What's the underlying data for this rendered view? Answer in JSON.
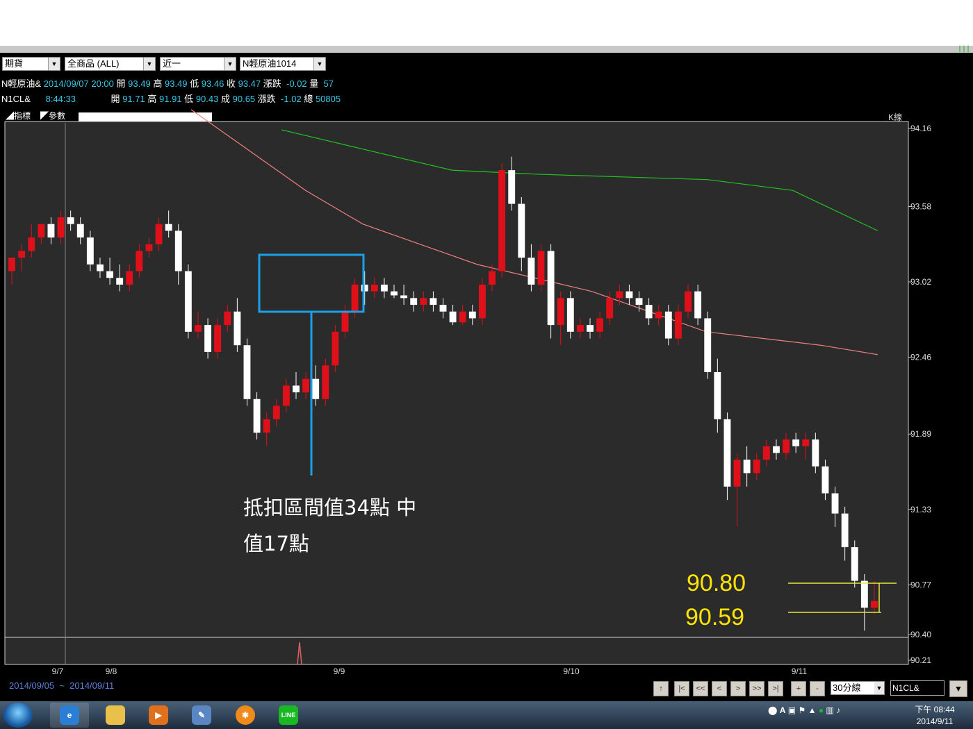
{
  "toolbar": {
    "market_select": "期貨",
    "product_select": "全商品    (ALL)",
    "month_select": "近一",
    "contract_select": "N輕原油1014"
  },
  "quote": {
    "row1": {
      "symbol": "N輕原油&",
      "datetime": "2014/09/07 20:00",
      "open_label": "開",
      "open": "93.49",
      "high_label": "高",
      "high": "93.49",
      "low_label": "低",
      "low": "93.46",
      "close_label": "收",
      "close": "93.47",
      "change_label": "漲跌",
      "change": "-0.02",
      "volume_label": "量",
      "volume": "57"
    },
    "row2": {
      "symbol": "N1CL&",
      "time": "8:44:33",
      "open_label": "開",
      "open": "91.71",
      "high_label": "高",
      "high": "91.91",
      "low_label": "低",
      "low": "90.43",
      "close_label": "成",
      "close": "90.65",
      "change_label": "漲跌",
      "change": "-1.02",
      "volume_label": "總",
      "volume": "50805"
    }
  },
  "indicator_bar": {
    "indicator_label": "指標",
    "param_label": "參數",
    "chart_type": "K線"
  },
  "chart_data": {
    "type": "candlestick",
    "symbol": "N1CL&",
    "interval": "30分線",
    "y_ticks": [
      "94.16",
      "93.58",
      "93.02",
      "92.46",
      "91.89",
      "91.33",
      "90.77",
      "90.40",
      "90.21"
    ],
    "ylim": [
      90.21,
      94.16
    ],
    "x_ticks": [
      "9/7",
      "9/8",
      "9/9",
      "9/10",
      "9/11"
    ],
    "candles": [
      [
        93.1,
        93.2,
        93.0,
        93.2
      ],
      [
        93.2,
        93.3,
        93.1,
        93.25
      ],
      [
        93.25,
        93.45,
        93.2,
        93.35
      ],
      [
        93.35,
        93.45,
        93.3,
        93.45
      ],
      [
        93.45,
        93.5,
        93.3,
        93.35
      ],
      [
        93.35,
        93.55,
        93.3,
        93.5
      ],
      [
        93.5,
        93.55,
        93.4,
        93.45
      ],
      [
        93.45,
        93.5,
        93.3,
        93.35
      ],
      [
        93.35,
        93.4,
        93.1,
        93.15
      ],
      [
        93.15,
        93.2,
        93.05,
        93.1
      ],
      [
        93.1,
        93.2,
        93.0,
        93.05
      ],
      [
        93.05,
        93.15,
        92.95,
        93.0
      ],
      [
        93.0,
        93.15,
        92.95,
        93.1
      ],
      [
        93.1,
        93.3,
        93.05,
        93.25
      ],
      [
        93.25,
        93.35,
        93.2,
        93.3
      ],
      [
        93.3,
        93.5,
        93.25,
        93.45
      ],
      [
        93.45,
        93.55,
        93.35,
        93.4
      ],
      [
        93.4,
        93.45,
        93.0,
        93.1
      ],
      [
        93.1,
        93.15,
        92.6,
        92.65
      ],
      [
        92.65,
        92.8,
        92.6,
        92.7
      ],
      [
        92.7,
        92.75,
        92.45,
        92.5
      ],
      [
        92.5,
        92.75,
        92.45,
        92.7
      ],
      [
        92.7,
        92.85,
        92.65,
        92.8
      ],
      [
        92.8,
        92.9,
        92.5,
        92.55
      ],
      [
        92.55,
        92.6,
        92.1,
        92.15
      ],
      [
        92.15,
        92.2,
        91.85,
        91.9
      ],
      [
        91.9,
        92.05,
        91.8,
        92.0
      ],
      [
        92.0,
        92.15,
        91.95,
        92.1
      ],
      [
        92.1,
        92.3,
        92.05,
        92.25
      ],
      [
        92.25,
        92.35,
        92.15,
        92.2
      ],
      [
        92.2,
        92.35,
        92.15,
        92.3
      ],
      [
        92.3,
        92.4,
        92.1,
        92.15
      ],
      [
        92.15,
        92.45,
        92.1,
        92.4
      ],
      [
        92.4,
        92.7,
        92.35,
        92.65
      ],
      [
        92.65,
        92.85,
        92.6,
        92.8
      ],
      [
        92.8,
        93.05,
        92.75,
        93.0
      ],
      [
        93.0,
        93.1,
        92.85,
        92.95
      ],
      [
        92.95,
        93.05,
        92.9,
        93.0
      ],
      [
        93.0,
        93.05,
        92.9,
        92.95
      ],
      [
        92.95,
        93.0,
        92.9,
        92.92
      ],
      [
        92.92,
        93.0,
        92.85,
        92.9
      ],
      [
        92.9,
        92.95,
        92.8,
        92.85
      ],
      [
        92.85,
        92.95,
        92.8,
        92.9
      ],
      [
        92.9,
        92.95,
        92.8,
        92.85
      ],
      [
        92.85,
        92.9,
        92.75,
        92.8
      ],
      [
        92.8,
        92.85,
        92.7,
        92.72
      ],
      [
        92.72,
        92.85,
        92.7,
        92.8
      ],
      [
        92.8,
        92.85,
        92.7,
        92.75
      ],
      [
        92.75,
        93.05,
        92.7,
        93.0
      ],
      [
        93.0,
        93.15,
        92.95,
        93.1
      ],
      [
        93.1,
        93.9,
        93.05,
        93.85
      ],
      [
        93.85,
        93.95,
        93.55,
        93.6
      ],
      [
        93.6,
        93.65,
        93.1,
        93.2
      ],
      [
        93.2,
        93.3,
        92.95,
        93.0
      ],
      [
        93.0,
        93.3,
        92.95,
        93.25
      ],
      [
        93.25,
        93.3,
        92.6,
        92.7
      ],
      [
        92.7,
        92.95,
        92.55,
        92.9
      ],
      [
        92.9,
        92.95,
        92.6,
        92.65
      ],
      [
        92.65,
        92.75,
        92.6,
        92.7
      ],
      [
        92.7,
        92.75,
        92.6,
        92.65
      ],
      [
        92.65,
        92.8,
        92.6,
        92.75
      ],
      [
        92.75,
        92.95,
        92.7,
        92.9
      ],
      [
        92.9,
        93.0,
        92.85,
        92.95
      ],
      [
        92.95,
        93.0,
        92.85,
        92.9
      ],
      [
        92.9,
        92.95,
        92.8,
        92.85
      ],
      [
        92.85,
        92.9,
        92.7,
        92.75
      ],
      [
        92.75,
        92.85,
        92.7,
        92.8
      ],
      [
        92.8,
        92.85,
        92.55,
        92.6
      ],
      [
        92.6,
        92.85,
        92.55,
        92.8
      ],
      [
        92.8,
        93.0,
        92.75,
        92.95
      ],
      [
        92.95,
        93.0,
        92.7,
        92.75
      ],
      [
        92.75,
        92.8,
        92.3,
        92.35
      ],
      [
        92.35,
        92.45,
        91.9,
        92.0
      ],
      [
        92.0,
        92.05,
        91.4,
        91.5
      ],
      [
        91.5,
        91.75,
        91.2,
        91.7
      ],
      [
        91.7,
        91.8,
        91.5,
        91.6
      ],
      [
        91.6,
        91.75,
        91.55,
        91.7
      ],
      [
        91.7,
        91.85,
        91.65,
        91.8
      ],
      [
        91.8,
        91.85,
        91.7,
        91.75
      ],
      [
        91.75,
        91.9,
        91.7,
        91.85
      ],
      [
        91.85,
        91.9,
        91.75,
        91.8
      ],
      [
        91.8,
        91.9,
        91.7,
        91.85
      ],
      [
        91.85,
        91.9,
        91.6,
        91.65
      ],
      [
        91.65,
        91.7,
        91.4,
        91.45
      ],
      [
        91.45,
        91.5,
        91.2,
        91.3
      ],
      [
        91.3,
        91.35,
        90.95,
        91.05
      ],
      [
        91.05,
        91.1,
        90.75,
        90.8
      ],
      [
        90.8,
        90.85,
        90.43,
        90.6
      ],
      [
        90.6,
        90.8,
        90.55,
        90.65
      ]
    ],
    "ma_series": [
      {
        "color": "#f08080",
        "values": [
          94.3,
          94.0,
          93.7,
          93.45,
          93.3,
          93.15,
          93.05,
          92.95,
          92.8,
          92.65,
          92.6,
          92.55,
          92.48
        ]
      },
      {
        "color": "#22c322",
        "values": [
          94.15,
          94.0,
          93.85,
          93.82,
          93.8,
          93.78,
          93.7,
          93.4
        ]
      }
    ],
    "annotations": [
      {
        "text": "抵扣區間值34點 中",
        "color": "#ffffff"
      },
      {
        "text": "值17點",
        "color": "#ffffff"
      },
      {
        "text": "90.80",
        "color": "#ffe400"
      },
      {
        "text": "90.59",
        "color": "#ffe400"
      }
    ],
    "volume_spike_label": "",
    "grid": false
  },
  "footer": {
    "date_from": "2014/09/05",
    "date_sep": "~",
    "date_to": "2014/09/11",
    "nav_buttons": [
      "↑",
      "|<",
      "<<",
      "<",
      ">",
      ">>",
      ">|",
      "+",
      "-"
    ],
    "period": "30分線",
    "symbol_input": "N1CL&"
  },
  "taskbar": {
    "apps": [
      "ie",
      "explorer",
      "media",
      "tool",
      "stars",
      "line"
    ],
    "line_label": "LINE",
    "clock_line1": "下午 08:44",
    "clock_line2": "2014/9/11"
  }
}
